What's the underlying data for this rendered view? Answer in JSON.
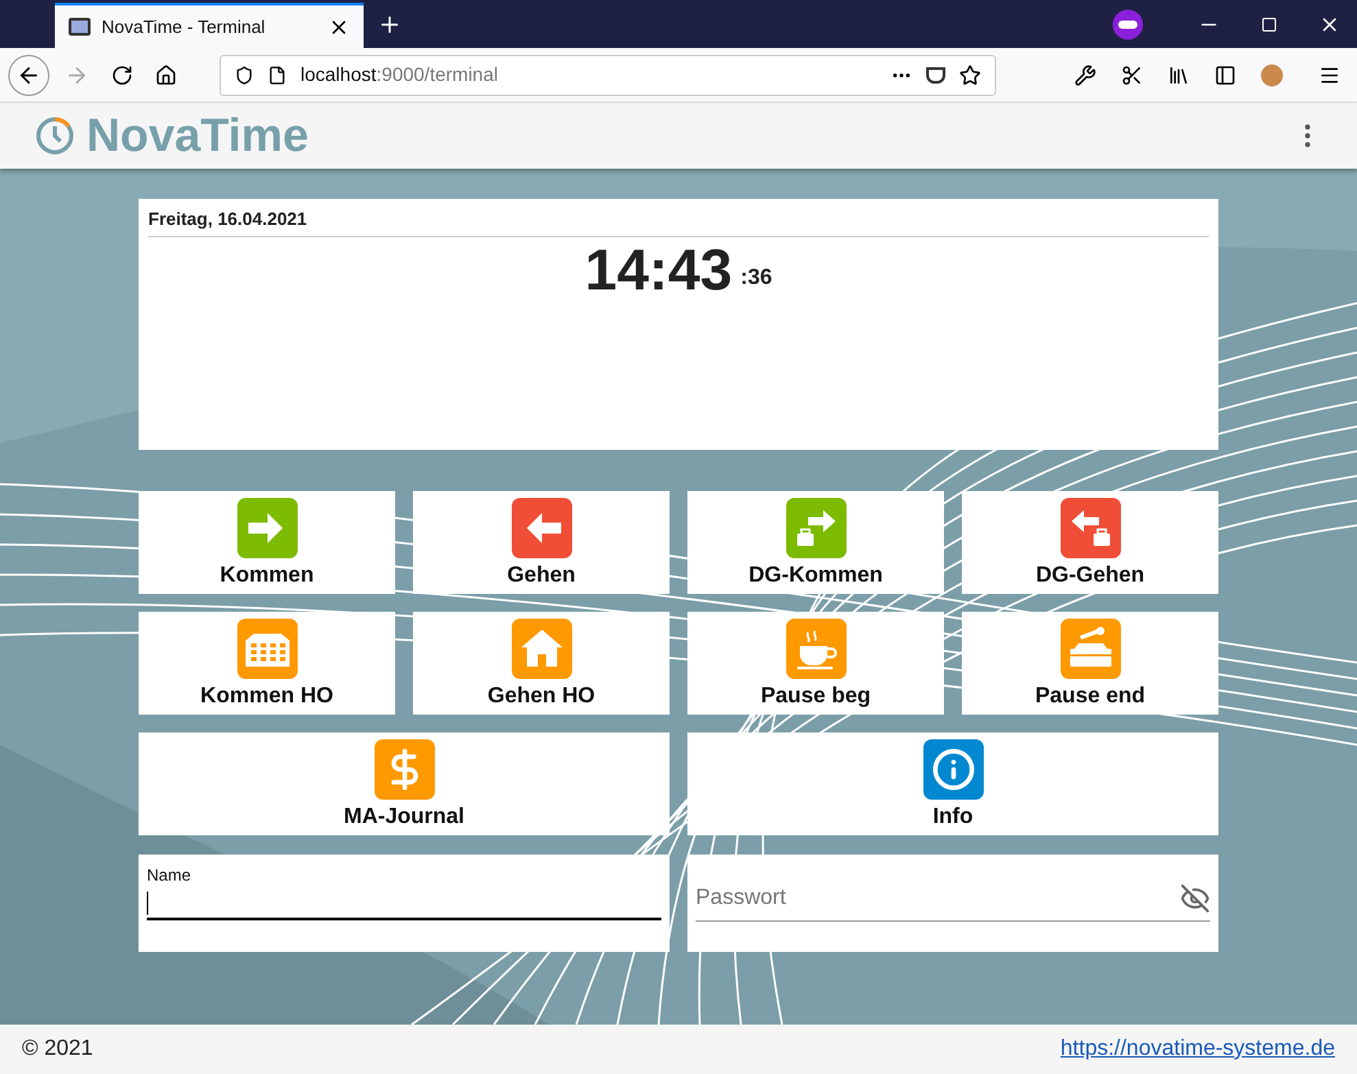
{
  "browser": {
    "tab": {
      "title": "NovaTime - Terminal",
      "selected": true
    },
    "url": {
      "host": "localhost",
      "path": ":9000/terminal"
    },
    "back_disabled": false,
    "forward_disabled": true
  },
  "app": {
    "logo": "NovaTime"
  },
  "clock": {
    "date": "Freitag, 16.04.2021",
    "time": "14:43",
    "seconds": ":36"
  },
  "actions": [
    {
      "label": "Kommen",
      "kind": "in",
      "color": "#7cbb00"
    },
    {
      "label": "Gehen",
      "kind": "out",
      "color": "#f04e37"
    },
    {
      "label": "DG-Kommen",
      "kind": "tripin",
      "color": "#7cbb00"
    },
    {
      "label": "DG-Gehen",
      "kind": "tripout",
      "color": "#f04e37"
    },
    {
      "label": "Kommen HO",
      "kind": "office",
      "color": "#ff9900"
    },
    {
      "label": "Gehen HO",
      "kind": "home",
      "color": "#ff9900"
    },
    {
      "label": "Pause beg",
      "kind": "break",
      "color": "#ff9900"
    },
    {
      "label": "Pause end",
      "kind": "resume",
      "color": "#ff9900"
    },
    {
      "label": "MA-Journal",
      "kind": "journal",
      "color": "#ff9900"
    },
    {
      "label": "Info",
      "kind": "info",
      "color": "#0288d1"
    }
  ],
  "login": {
    "name": {
      "label": "Name",
      "focused": true
    },
    "password": {
      "placeholder": "Passwort"
    }
  },
  "footer": {
    "copyright": "© 2021",
    "link": "https://novatime-systeme.de"
  }
}
